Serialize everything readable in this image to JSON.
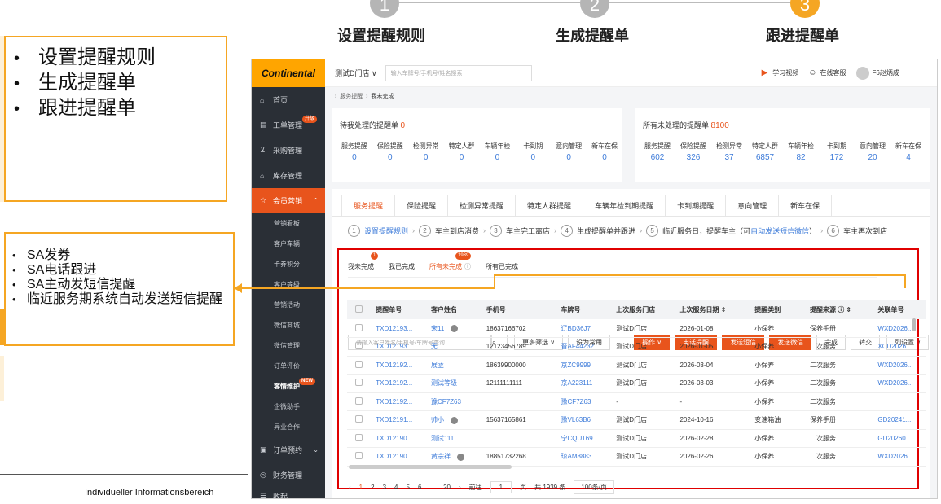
{
  "steps": [
    {
      "num": "1",
      "title": "设置提醒规则",
      "color": "#b5b5b5"
    },
    {
      "num": "2",
      "title": "生成提醒单",
      "color": "#b5b5b5"
    },
    {
      "num": "3",
      "title": "跟进提醒单",
      "color": "#f5a623"
    }
  ],
  "box1": {
    "items": [
      "设置提醒规则",
      "生成提醒单",
      "跟进提醒单"
    ]
  },
  "box2": {
    "items": [
      "SA发券",
      "SA电话跟进",
      "SA主动发短信提醒",
      "临近服务期系统自动发送短信提醒"
    ]
  },
  "footer": "Individueller Informationsbereich",
  "app": {
    "logo": "Continental",
    "store": "测试D门店 ∨",
    "search_placeholder": "输入车牌号/手机号/姓名搜索",
    "video": "学习视频",
    "service": "在线客服",
    "user": "F6赵炳成",
    "breadcrumb": [
      "服务提醒",
      "我未完成"
    ],
    "nav": [
      {
        "icon": "home-icon",
        "label": "首页"
      },
      {
        "icon": "order-icon",
        "label": "工单管理",
        "badge": "升级"
      },
      {
        "icon": "cart-icon",
        "label": "采购管理"
      },
      {
        "icon": "warehouse-icon",
        "label": "库存管理"
      },
      {
        "icon": "member-icon",
        "label": "会员营销",
        "active": true
      }
    ],
    "subnav": [
      "营销看板",
      "客户车辆",
      "卡券积分",
      "客户等级",
      "营销活动",
      "微信商城",
      "微信管理",
      "订单评价",
      "客情维护",
      "企微助手",
      "异业合作"
    ],
    "subnav_badge": "NEW",
    "nav_bottom": [
      {
        "icon": "calendar-icon",
        "label": "订单预约"
      },
      {
        "icon": "finance-icon",
        "label": "财务管理"
      },
      {
        "icon": "collapse-icon",
        "label": "收起"
      }
    ],
    "my_pending": {
      "title": "待我处理的提醒单",
      "count": "0",
      "items": [
        [
          "服务提醒",
          "0"
        ],
        [
          "保险提醒",
          "0"
        ],
        [
          "检测异常",
          "0"
        ],
        [
          "特定人群",
          "0"
        ],
        [
          "车辆年检",
          "0"
        ],
        [
          "卡到期",
          "0"
        ],
        [
          "意向管理",
          "0"
        ],
        [
          "新车在保",
          "0"
        ]
      ]
    },
    "all_pending": {
      "title": "所有未处理的提醒单",
      "count": "8100",
      "items": [
        [
          "服务提醒",
          "602"
        ],
        [
          "保险提醒",
          "326"
        ],
        [
          "检测异常",
          "37"
        ],
        [
          "特定人群",
          "6857"
        ],
        [
          "车辆年检",
          "82"
        ],
        [
          "卡到期",
          "172"
        ],
        [
          "意向管理",
          "20"
        ],
        [
          "新车在保",
          "4"
        ]
      ]
    },
    "tabs": [
      "服务提醒",
      "保险提醒",
      "检测异常提醒",
      "特定人群提醒",
      "车辆年检到期提醒",
      "卡到期提醒",
      "意向管理",
      "新车在保"
    ],
    "flow": [
      [
        "1",
        "设置提醒规则"
      ],
      [
        "2",
        "车主到店消费"
      ],
      [
        "3",
        "车主完工离店"
      ],
      [
        "4",
        "生成提醒单并跟进"
      ],
      [
        "5",
        "临近服务日，提醒车主（可"
      ],
      [
        "6",
        "车主再次到店"
      ]
    ],
    "flow_link": "自动发送短信微信",
    "flow_end": "）",
    "subtabs": [
      {
        "label": "我未完成",
        "badge": "1"
      },
      {
        "label": "我已完成"
      },
      {
        "label": "所有未完成",
        "badge": "1939"
      },
      {
        "label": "所有已完成"
      }
    ],
    "filter_placeholder": "请输入客户姓名/手机号/车牌号查询",
    "more_filter": "更多筛选 ∨",
    "set_common": "设为常用",
    "buttons": {
      "op": "操作 ∨",
      "call": "电话提醒",
      "sms": "发送短信",
      "wechat": "发送微信",
      "done": "完成",
      "transfer": "转交",
      "cols": "列设置 ∨"
    },
    "columns": [
      "提醒单号",
      "客户姓名",
      "手机号",
      "车牌号",
      "上次服务门店",
      "上次服务日期 ⇕",
      "提醒类别",
      "提醒来源 ⓘ ⇕",
      "关联单号"
    ],
    "rows": [
      [
        "TXD12193...",
        "宋11",
        "18637166702",
        "辽BD36J7",
        "测试D门店",
        "2026-01-08",
        "小保养",
        "保养手册",
        "WXD2026..."
      ],
      [
        "TXD12193...",
        "无",
        "12123456789",
        "晋AF44232",
        "测试D门店",
        "2026-01-05",
        "小保养",
        "二次服务",
        "XCD2026..."
      ],
      [
        "TXD12192...",
        "展丞",
        "18639900000",
        "京ZC9999",
        "测试D门店",
        "2026-03-04",
        "小保养",
        "二次服务",
        "WXD2026..."
      ],
      [
        "TXD12192...",
        "测试等级",
        "12111111111",
        "京A223111",
        "测试D门店",
        "2026-03-03",
        "小保养",
        "二次服务",
        "WXD2026..."
      ],
      [
        "TXD12192...",
        "豫CF7Z63",
        "",
        "豫CF7Z63",
        "-",
        "-",
        "小保养",
        "二次服务",
        ""
      ],
      [
        "TXD12191...",
        "帅小",
        "15637165861",
        "豫VL63B6",
        "测试D门店",
        "2024-10-16",
        "变速箱油",
        "保养手册",
        "GD20241..."
      ],
      [
        "TXD12190...",
        "测试111",
        "",
        "宁CQU169",
        "测试D门店",
        "2026-02-28",
        "小保养",
        "二次服务",
        "GD20260..."
      ],
      [
        "TXD12190...",
        "黄宗祥",
        "18851732268",
        "琼AM8883",
        "测试D门店",
        "2026-02-26",
        "小保养",
        "二次服务",
        "WXD2026..."
      ]
    ],
    "pager": {
      "pages": [
        "1",
        "2",
        "3",
        "4",
        "5",
        "6",
        "...",
        "20"
      ],
      "goto": "前往",
      "page_input": "1",
      "page_unit": "页",
      "total": "共 1939 条",
      "size": "100条/页"
    }
  }
}
